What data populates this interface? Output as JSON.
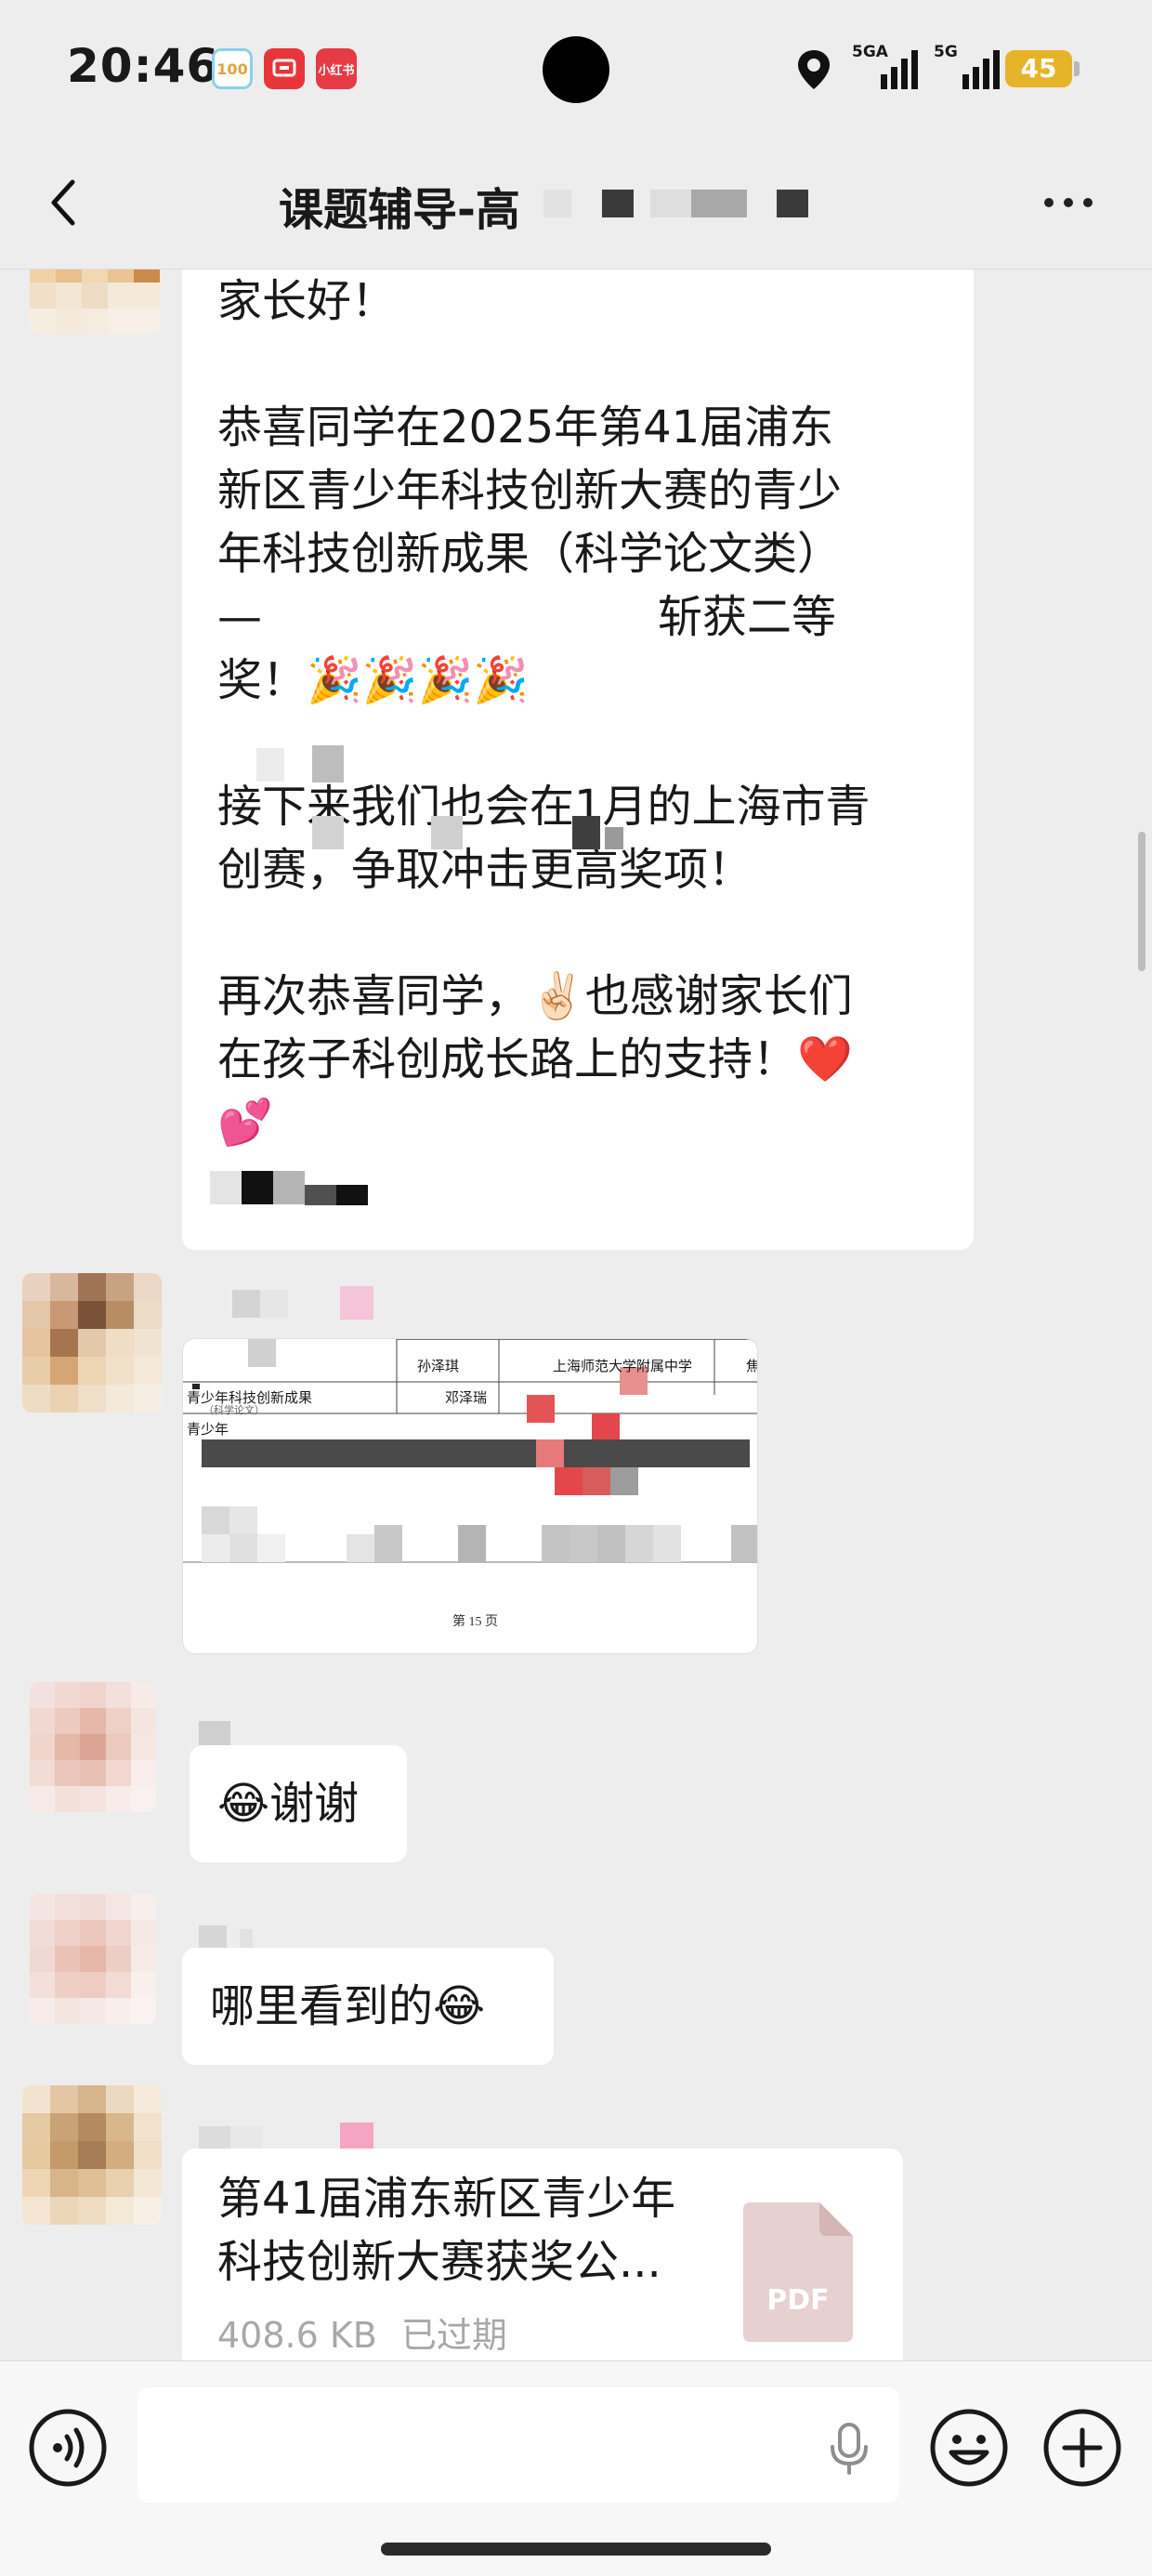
{
  "status_bar": {
    "time": "20:46",
    "app_icons": [
      "100",
      "",
      "小红书"
    ],
    "signal_1": "5GA",
    "signal_2": "5G",
    "battery": "45"
  },
  "nav": {
    "title": "课题辅导-高",
    "back_icon": "chevron-left-icon",
    "more_icon": "more-dots-icon"
  },
  "messages": {
    "announcement": {
      "lines": [
        "家长好！",
        "",
        "恭喜同学在2025年第41届浦东",
        "新区青少年科技创新大赛的青少",
        "年科技创新成果（科学论文类）",
        "—",
        "奖！🎉🎉🎉🎉",
        "",
        "接下来我们也会在1月的上海市青",
        "创赛，争取冲击更高奖项！",
        "",
        "再次恭喜同学，✌🏻也感谢家长们",
        "在孩子科创成长路上的支持！❤️",
        "💕"
      ],
      "award_fragment": "斩获二等"
    },
    "image_message": {
      "header_cells": [
        "孙泽琪",
        "上海师范大学附属中学",
        "焦"
      ],
      "row_labels": [
        "青少年科技创新成果",
        "（科学论文）",
        "青少年"
      ],
      "cell_name": "邓泽瑞",
      "page_label": "第 15 页"
    },
    "thanks": "😂谢谢",
    "where_seen": "哪里看到的😂",
    "file": {
      "title_line1": "第41届浦东新区青少年",
      "title_line2": "科技创新大赛获奖公...",
      "size": "408.6 KB",
      "status": "已过期",
      "type_label": "PDF"
    }
  },
  "input_bar": {
    "voice_icon": "voice-input-icon",
    "mic_icon": "microphone-icon",
    "emoji_icon": "emoji-icon",
    "plus_icon": "plus-icon"
  }
}
